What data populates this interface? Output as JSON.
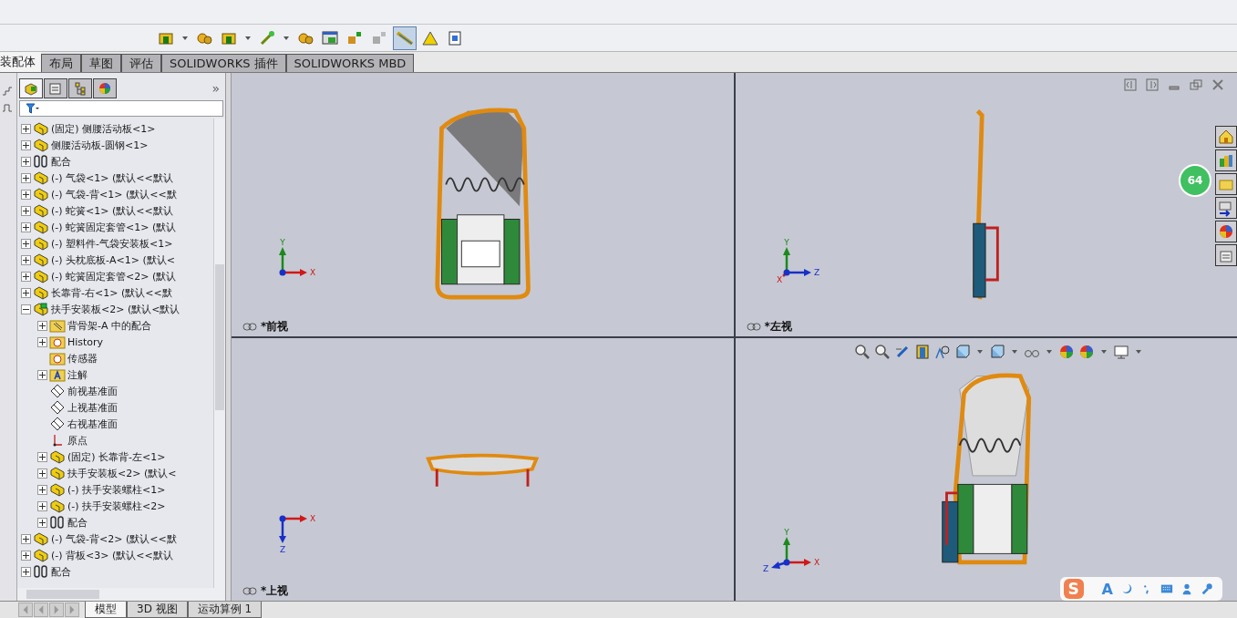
{
  "command_tabs": [
    {
      "label": "装配体",
      "selected": true
    },
    {
      "label": "布局",
      "selected": false
    },
    {
      "label": "草图",
      "selected": false
    },
    {
      "label": "评估",
      "selected": false
    },
    {
      "label": "SOLIDWORKS 插件",
      "selected": false
    },
    {
      "label": "SOLIDWORKS MBD",
      "selected": false
    }
  ],
  "panel_tabs": [
    {
      "kind": "tree",
      "selected": true
    },
    {
      "kind": "property",
      "selected": false
    },
    {
      "kind": "config",
      "selected": false
    },
    {
      "kind": "display",
      "selected": false
    }
  ],
  "panel_more": "»",
  "tree": [
    {
      "children": [
        {
          "label": "(固定) 侧腰活动板<1>",
          "kind": "part",
          "expanded": false
        },
        {
          "label": "侧腰活动板-圆钢<1>",
          "kind": "part",
          "expanded": false
        },
        {
          "label": "配合",
          "kind": "mates",
          "expanded": false
        }
      ]
    },
    {
      "label": "(-) 气袋<1> (默认<<默认",
      "kind": "part",
      "expanded": false
    },
    {
      "label": "(-) 气袋-背<1> (默认<<默",
      "kind": "part",
      "expanded": false
    },
    {
      "label": "(-) 蛇簧<1> (默认<<默认",
      "kind": "part",
      "expanded": false
    },
    {
      "label": "(-) 蛇簧固定套管<1> (默认",
      "kind": "part",
      "expanded": false
    },
    {
      "label": "(-) 塑料件-气袋安装板<1>",
      "kind": "part",
      "expanded": false
    },
    {
      "label": "(-) 头枕底板-A<1> (默认<",
      "kind": "part",
      "expanded": false
    },
    {
      "label": "(-) 蛇簧固定套管<2> (默认",
      "kind": "part",
      "expanded": false
    },
    {
      "label": "长靠背-右<1> (默认<<默",
      "kind": "part",
      "expanded": false
    },
    {
      "label": "扶手安装板<2> (默认<默认",
      "kind": "assembly",
      "expanded": true,
      "children": [
        {
          "label": "背骨架-A 中的配合",
          "kind": "folder",
          "expanded": false
        },
        {
          "label": "History",
          "kind": "history",
          "expanded": false
        },
        {
          "label": "传感器",
          "kind": "sensor"
        },
        {
          "label": "注解",
          "kind": "annotation",
          "expanded": false
        },
        {
          "label": "前视基准面",
          "kind": "plane"
        },
        {
          "label": "上视基准面",
          "kind": "plane"
        },
        {
          "label": "右视基准面",
          "kind": "plane"
        },
        {
          "label": "原点",
          "kind": "origin"
        },
        {
          "label": "(固定) 长靠背-左<1>",
          "kind": "part",
          "expanded": false
        },
        {
          "label": "扶手安装板<2> (默认<",
          "kind": "part",
          "expanded": false
        },
        {
          "label": "(-) 扶手安装螺柱<1>",
          "kind": "part",
          "expanded": false
        },
        {
          "label": "(-) 扶手安装螺柱<2>",
          "kind": "part",
          "expanded": false
        },
        {
          "label": "配合",
          "kind": "mates",
          "expanded": false
        }
      ]
    },
    {
      "label": "(-) 气袋-背<2> (默认<<默",
      "kind": "part",
      "expanded": false
    },
    {
      "label": "(-) 背板<3> (默认<<默认",
      "kind": "part",
      "expanded": false
    },
    {
      "label": "配合",
      "kind": "mates",
      "expanded": false
    }
  ],
  "views": [
    {
      "kind": "front",
      "label": "*前视",
      "axes": [
        {
          "letter": "Y",
          "kind": "up",
          "color": "#1a8a1a"
        },
        {
          "letter": "X",
          "kind": "right",
          "color": "#d01818"
        }
      ]
    },
    {
      "kind": "left",
      "label": "*左视",
      "axes": [
        {
          "letter": "Y",
          "kind": "up",
          "color": "#1a8a1a"
        },
        {
          "letter": "Z",
          "kind": "right",
          "color": "#1830c8"
        },
        {
          "letter": "X",
          "kind": "dot",
          "color": "#d01818"
        }
      ]
    },
    {
      "kind": "top",
      "label": "*上视",
      "axes": [
        {
          "letter": "X",
          "kind": "right",
          "color": "#d01818"
        },
        {
          "letter": "Z",
          "kind": "down",
          "color": "#1830c8"
        }
      ]
    },
    {
      "kind": "iso",
      "axes": [
        {
          "letter": "Y",
          "kind": "up",
          "color": "#1a8a1a"
        },
        {
          "letter": "X",
          "kind": "right",
          "color": "#d01818"
        },
        {
          "letter": "Z",
          "kind": "left",
          "color": "#1830c8"
        }
      ]
    }
  ],
  "speed_badge": "64",
  "ime_bar": {
    "logo": "S",
    "mode": "A"
  },
  "bottom_tabs": [
    {
      "label": "模型",
      "selected": true
    },
    {
      "label": "3D 视图",
      "selected": false
    },
    {
      "label": "运动算例 1",
      "selected": false
    }
  ]
}
